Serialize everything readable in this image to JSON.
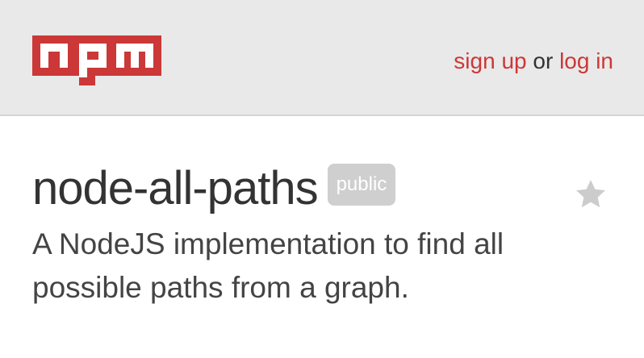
{
  "header": {
    "logo_text": "npm",
    "signup_label": "sign up",
    "separator": "or",
    "login_label": "log in"
  },
  "package": {
    "name": "node-all-paths",
    "visibility_badge": "public",
    "description": "A NodeJS implementation to find all possible paths from a graph."
  },
  "icons": {
    "logo": "npm-logo",
    "star": "star-icon"
  },
  "colors": {
    "brand_red": "#cb3837",
    "header_bg": "#e9e9e9",
    "badge_bg": "#cfcfcf",
    "star_gray": "#cccccc"
  }
}
